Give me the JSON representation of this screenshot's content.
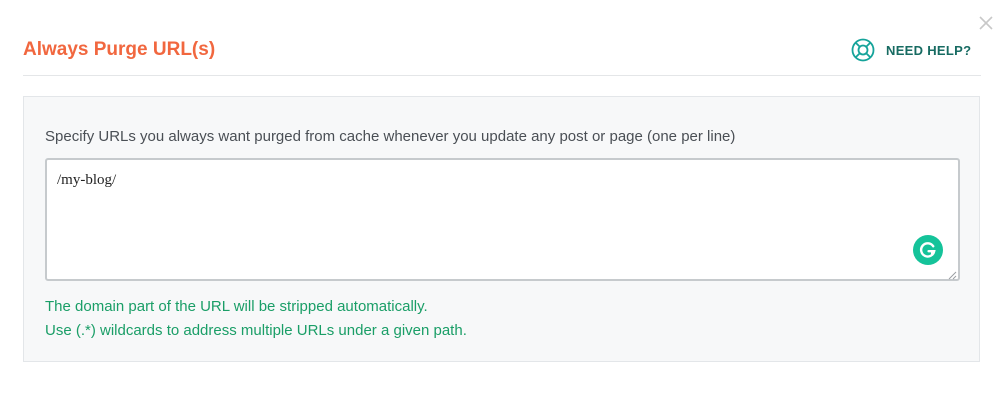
{
  "dialog": {
    "title": "Always Purge URL(s)",
    "title_color": "#f1673f",
    "close_icon": "close-icon",
    "help": {
      "label": "NEED HELP?",
      "icon": "lifebuoy-icon",
      "color": "#176b62"
    }
  },
  "form": {
    "instructions": "Specify URLs you always want purged from cache whenever you update any post or page (one per line)",
    "urls_value": "/my-blog/",
    "grammarly_icon": "grammarly-icon",
    "hints": [
      "The domain part of the URL will be stripped automatically.",
      "Use (.*) wildcards to address multiple URLs under a given path."
    ],
    "hint_color": "#1a9e67"
  }
}
